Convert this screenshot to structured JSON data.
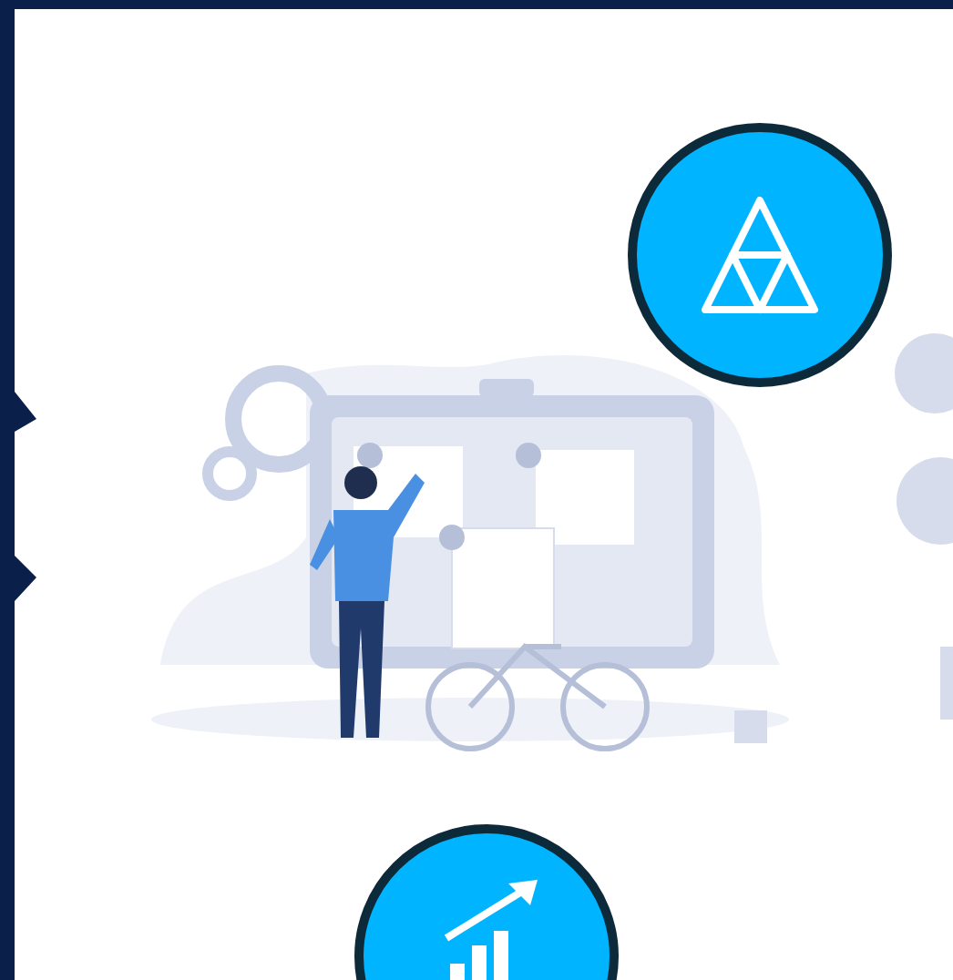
{
  "badges": [
    {
      "kind": "triangle"
    },
    {
      "kind": "chart"
    }
  ]
}
